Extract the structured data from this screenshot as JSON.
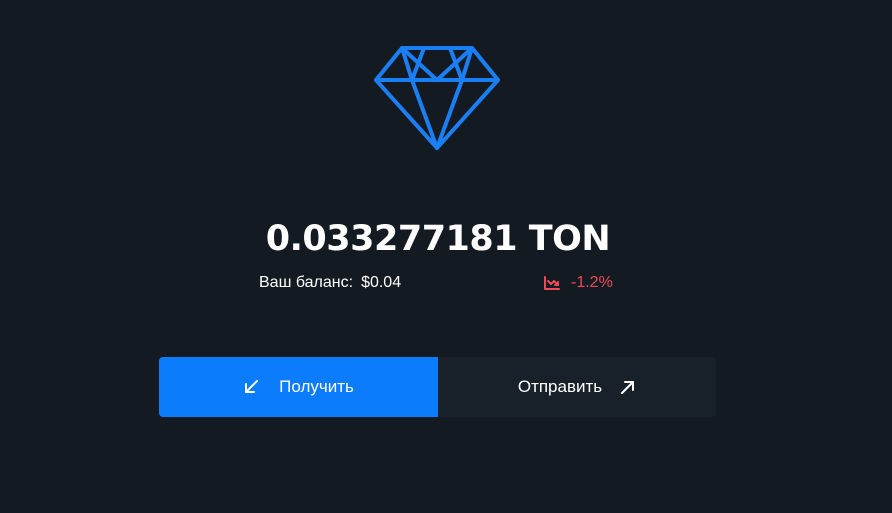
{
  "wallet": {
    "icon": "diamond-icon",
    "accent_color": "#1a7ff5",
    "amount": "0.033277181 TON",
    "balance_label": "Ваш баланс:",
    "balance_value": "$0.04",
    "change_icon": "trend-down-icon",
    "change": "-1.2%",
    "change_color": "#ee4a57"
  },
  "actions": {
    "receive": {
      "label": "Получить",
      "icon": "arrow-down-left-icon",
      "color": "#0a7cfc"
    },
    "send": {
      "label": "Отправить",
      "icon": "arrow-up-right-icon",
      "color": "#18202a"
    }
  }
}
